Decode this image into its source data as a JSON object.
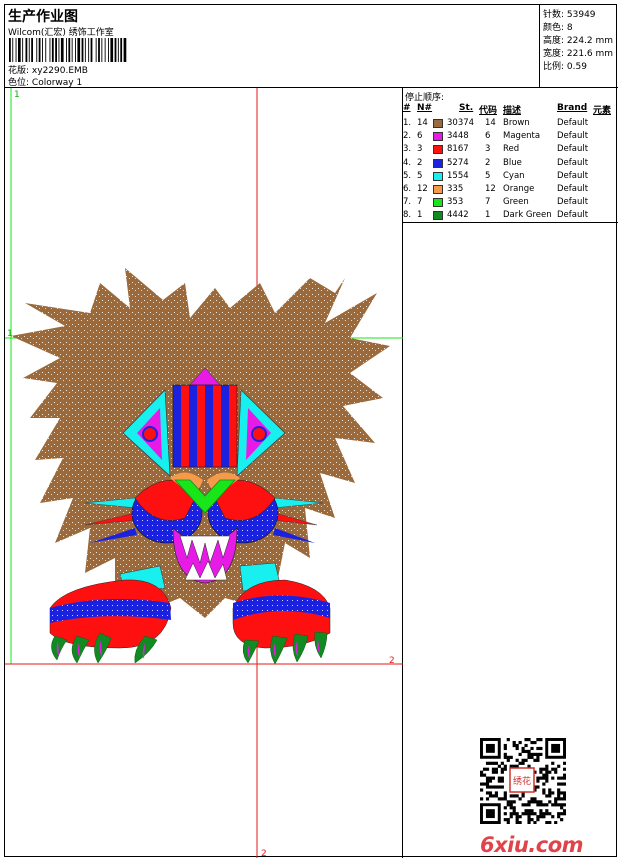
{
  "header": {
    "title": "生产作业图",
    "company": "Wilcom(汇宏) 绣饰工作室",
    "pattern_label": "花版:",
    "pattern_value": "xy2290.EMB",
    "colorway_label": "色位:",
    "colorway_value": "Colorway 1"
  },
  "stats": {
    "stitches": "针数: 53949",
    "colors": "颜色: 8",
    "height": "高度: 224.2 mm",
    "width": "宽度: 221.6 mm",
    "scale": "比例: 0.59"
  },
  "design": {
    "marker_1_top": "1",
    "marker_1_left": "1",
    "marker_2_right": "2",
    "marker_2_bottom": "2"
  },
  "stop_sequence": {
    "title": "停止顺序:",
    "headers": [
      "#",
      "N#",
      "St.",
      "代码",
      "描述",
      "Brand",
      "元素"
    ],
    "rows": [
      {
        "idx": "1.",
        "n": "14",
        "color": "#9a6a3c",
        "st": "30374",
        "code": "14",
        "desc": "Brown",
        "brand": "Default"
      },
      {
        "idx": "2.",
        "n": "6",
        "color": "#e61ce6",
        "st": "3448",
        "code": "6",
        "desc": "Magenta",
        "brand": "Default"
      },
      {
        "idx": "3.",
        "n": "3",
        "color": "#ff1010",
        "st": "8167",
        "code": "3",
        "desc": "Red",
        "brand": "Default"
      },
      {
        "idx": "4.",
        "n": "2",
        "color": "#1a22e0",
        "st": "5274",
        "code": "2",
        "desc": "Blue",
        "brand": "Default"
      },
      {
        "idx": "5.",
        "n": "5",
        "color": "#18f0f0",
        "st": "1554",
        "code": "5",
        "desc": "Cyan",
        "brand": "Default"
      },
      {
        "idx": "6.",
        "n": "12",
        "color": "#f59a4a",
        "st": "335",
        "code": "12",
        "desc": "Orange",
        "brand": "Default"
      },
      {
        "idx": "7.",
        "n": "7",
        "color": "#19e619",
        "st": "353",
        "code": "7",
        "desc": "Green",
        "brand": "Default"
      },
      {
        "idx": "8.",
        "n": "1",
        "color": "#118a22",
        "st": "4442",
        "code": "1",
        "desc": "Dark Green",
        "brand": "Default"
      }
    ]
  },
  "watermark": {
    "logo_text": "6xiu.com",
    "stamp_text": "绣花"
  }
}
